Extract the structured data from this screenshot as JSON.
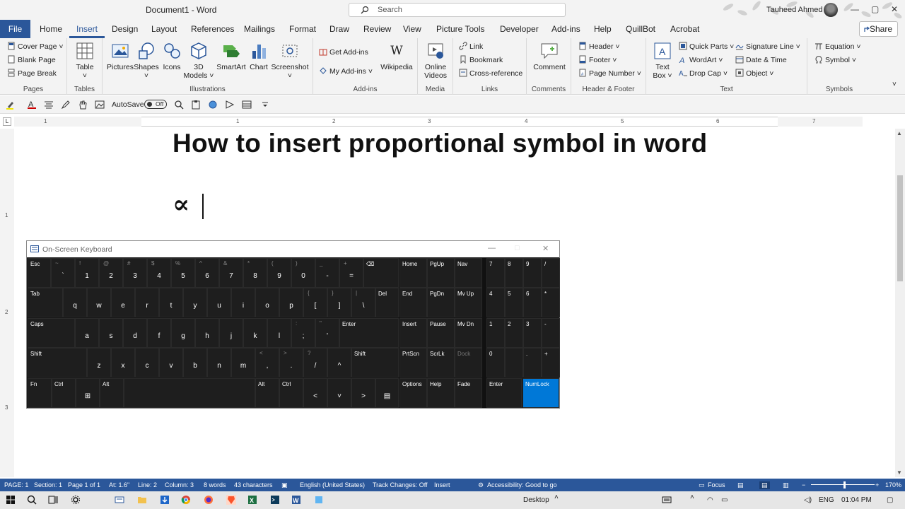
{
  "titlebar": {
    "doc_title": "Document1  -  Word",
    "search_placeholder": "Search",
    "user_name": "Tauheed Ahmed",
    "minimize": "—",
    "restore": "▢",
    "close": "✕"
  },
  "tabs": {
    "file": "File",
    "items": [
      "Home",
      "Insert",
      "Design",
      "Layout",
      "References",
      "Mailings",
      "Format",
      "Draw",
      "Review",
      "View",
      "Picture Tools",
      "Developer",
      "Add-ins",
      "Help",
      "QuillBot",
      "Acrobat"
    ],
    "active": "Insert",
    "share": "Share"
  },
  "ribbon": {
    "pages": {
      "label": "Pages",
      "cover_page": "Cover Page ˅",
      "blank_page": "Blank Page",
      "page_break": "Page Break"
    },
    "tables": {
      "label": "Tables",
      "table": "Table",
      "table_arrow": "˅"
    },
    "illustrations": {
      "label": "Illustrations",
      "pictures": "Pictures",
      "shapes": "Shapes",
      "icons": "Icons",
      "models": "3D",
      "models2": "Models ˅",
      "smartart": "SmartArt",
      "chart": "Chart",
      "screenshot": "Screenshot",
      "arrow": "˅"
    },
    "addins": {
      "label": "Add-ins",
      "get_addins": "Get Add-ins",
      "my_addins": "My Add-ins ˅",
      "wikipedia": "Wikipedia",
      "wiki_logo": "W"
    },
    "media": {
      "label": "Media",
      "online": "Online",
      "videos": "Videos"
    },
    "links": {
      "label": "Links",
      "link": "Link",
      "bookmark": "Bookmark",
      "crossref": "Cross-reference"
    },
    "comments": {
      "label": "Comments",
      "comment": "Comment"
    },
    "header_footer": {
      "label": "Header & Footer",
      "header": "Header ˅",
      "footer": "Footer ˅",
      "page_number": "Page Number ˅"
    },
    "text": {
      "label": "Text",
      "textbox": "Text",
      "textbox2": "Box ˅",
      "quick_parts": "Quick Parts ˅",
      "wordart": "WordArt ˅",
      "dropcap": "Drop Cap ˅",
      "signature": "Signature Line ˅",
      "datetime": "Date & Time",
      "object": "Object ˅"
    },
    "symbols": {
      "label": "Symbols",
      "equation": "Equation ˅",
      "symbol": "Symbol ˅"
    },
    "collapse": "˅"
  },
  "qat": {
    "autosave": "AutoSave",
    "toggle": "Off"
  },
  "ruler": {
    "h": [
      "1",
      "1",
      "2",
      "3",
      "4",
      "5",
      "6",
      "7"
    ],
    "v": [
      "1",
      "2",
      "3"
    ],
    "tabstop": "L"
  },
  "document": {
    "heading": "How to insert proportional symbol in word",
    "symbol": "∝"
  },
  "osk": {
    "title": "On-Screen Keyboard",
    "minimize": "—",
    "maximize": "□",
    "close": "✕",
    "row1": [
      {
        "l": "Esc"
      },
      {
        "t": "~",
        "m": "`"
      },
      {
        "t": "!",
        "m": "1"
      },
      {
        "t": "@",
        "m": "2"
      },
      {
        "t": "#",
        "m": "3"
      },
      {
        "t": "$",
        "m": "4"
      },
      {
        "t": "%",
        "m": "5"
      },
      {
        "t": "^",
        "m": "6"
      },
      {
        "t": "&",
        "m": "7"
      },
      {
        "t": "*",
        "m": "8"
      },
      {
        "t": "(",
        "m": "9"
      },
      {
        "t": ")",
        "m": "0"
      },
      {
        "t": "_",
        "m": "-"
      },
      {
        "t": "+",
        "m": "="
      },
      {
        "l": "⌫"
      }
    ],
    "row2": [
      {
        "l": "Tab"
      },
      {
        "m": "q"
      },
      {
        "m": "w"
      },
      {
        "m": "e"
      },
      {
        "m": "r"
      },
      {
        "m": "t"
      },
      {
        "m": "y"
      },
      {
        "m": "u"
      },
      {
        "m": "i"
      },
      {
        "m": "o"
      },
      {
        "m": "p"
      },
      {
        "t": "{",
        "m": "["
      },
      {
        "t": "}",
        "m": "]"
      },
      {
        "t": "|",
        "m": "\\"
      },
      {
        "l": "Del"
      }
    ],
    "row3": [
      {
        "l": "Caps"
      },
      {
        "m": "a"
      },
      {
        "m": "s"
      },
      {
        "m": "d"
      },
      {
        "m": "f"
      },
      {
        "m": "g"
      },
      {
        "m": "h"
      },
      {
        "m": "j"
      },
      {
        "m": "k"
      },
      {
        "m": "l"
      },
      {
        "t": ":",
        "m": ";"
      },
      {
        "t": "\"",
        "m": "'"
      },
      {
        "l": "Enter"
      }
    ],
    "row4": [
      {
        "l": "Shift"
      },
      {
        "m": "z"
      },
      {
        "m": "x"
      },
      {
        "m": "c"
      },
      {
        "m": "v"
      },
      {
        "m": "b"
      },
      {
        "m": "n"
      },
      {
        "m": "m"
      },
      {
        "t": "<",
        "m": ","
      },
      {
        "t": ">",
        "m": "."
      },
      {
        "t": "?",
        "m": "/"
      },
      {
        "m": "^"
      },
      {
        "l": "Shift"
      }
    ],
    "row5": [
      {
        "l": "Fn"
      },
      {
        "l": "Ctrl"
      },
      {
        "m": "⊞"
      },
      {
        "l": "Alt"
      },
      {
        "l": ""
      },
      {
        "l": "Alt"
      },
      {
        "l": "Ctrl"
      },
      {
        "m": "<"
      },
      {
        "m": "˅"
      },
      {
        "m": ">"
      },
      {
        "m": "▤"
      }
    ],
    "nav": [
      [
        "Home",
        "PgUp",
        "Nav"
      ],
      [
        "End",
        "PgDn",
        "Mv Up"
      ],
      [
        "Insert",
        "Pause",
        "Mv Dn"
      ],
      [
        "PrtScn",
        "ScrLk",
        "Dock"
      ],
      [
        "Options",
        "Help",
        "Fade"
      ]
    ],
    "numpad": [
      [
        "7",
        "8",
        "9",
        "/"
      ],
      [
        "4",
        "5",
        "6",
        "*"
      ],
      [
        "1",
        "2",
        "3",
        "-"
      ],
      [
        "0",
        "",
        ".",
        "+"
      ],
      [
        "Enter",
        "NumLock"
      ]
    ]
  },
  "status": {
    "page": "PAGE: 1",
    "section": "Section: 1",
    "pageof": "Page 1 of 1",
    "at": "At: 1.6\"",
    "line": "Line: 2",
    "column": "Column: 3",
    "words": "8 words",
    "chars": "43 characters",
    "language": "English (United States)",
    "track": "Track Changes: Off",
    "mode": "Insert",
    "access": "Accessibility: Good to go",
    "focus": "Focus",
    "zoom": "170%",
    "minus": "−",
    "plus": "+"
  },
  "taskbar": {
    "desktop": "Desktop",
    "chevron": "˄",
    "lang": "ENG",
    "time": "01:04 PM",
    "wifi": "◠",
    "volume": "◁)"
  },
  "colors": {
    "word_blue": "#2b579a",
    "numlock_blue": "#0078d7"
  }
}
